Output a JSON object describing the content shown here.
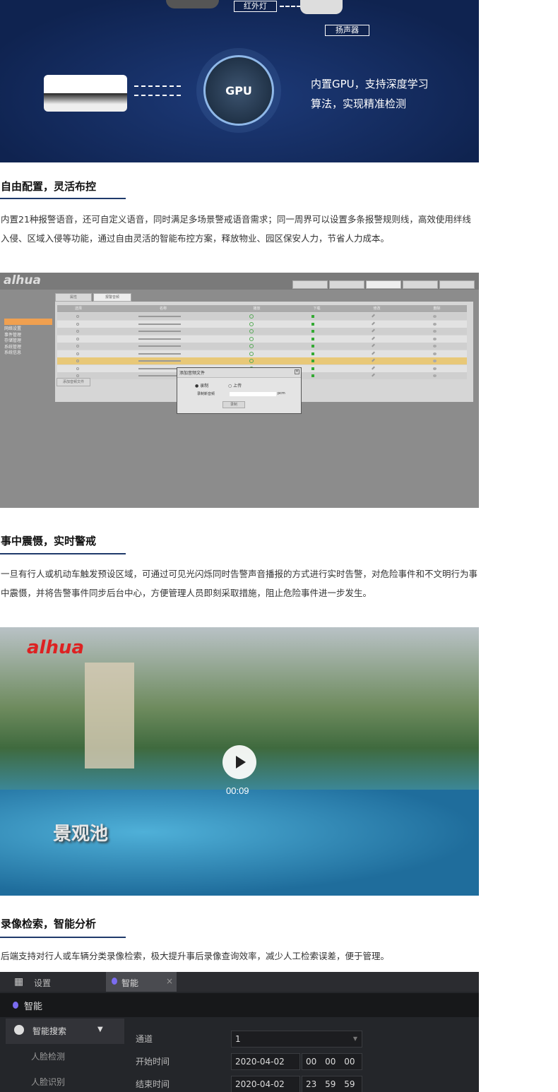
{
  "hero": {
    "label_ir": "红外灯",
    "label_speaker": "扬声器",
    "gpu_chip": "GPU",
    "gpu_text_1": "内置GPU，支持深度学习",
    "gpu_text_2": "算法，实现精准检测",
    "bg_color": "#142a5c"
  },
  "section1": {
    "title": "自由配置，灵活布控",
    "body": "内置21种报警语音，还可自定义语音，同时满足多场景警戒语音需求；同一周界可以设置多条报警规则线，高效使用绊线入侵、区域入侵等功能，通过自由灵活的智能布控方案，释放物业、园区保安人力，节省人力成本。"
  },
  "dahua_ui": {
    "logo": "alhua",
    "nav": [
      "网络设置",
      "事件管理",
      "存储管理",
      "系统管理",
      "系统信息"
    ],
    "tabs": [
      "属性",
      "报警音频"
    ],
    "columns": [
      "选择",
      "名称",
      "播放",
      "下载",
      "修改",
      "删除"
    ],
    "add_button": "添加音频文件",
    "dialog": {
      "title": "添加音频文件",
      "radio_record": "录制",
      "radio_upload": "上传",
      "field_label": "录制新音频",
      "suffix": "pcm",
      "button": "录制"
    }
  },
  "section2": {
    "title": "事中震慑，实时警戒",
    "body": "一旦有行人或机动车触发预设区域，可通过可见光闪烁同时告警声音播报的方式进行实时告警，对危险事件和不文明行为事中震慑，并将告警事件同步后台中心，方便管理人员即刻采取措施，阻止危险事件进一步发生。"
  },
  "video": {
    "logo": "alhua",
    "caption": "景观池",
    "duration": "00:09",
    "icon": "play-icon"
  },
  "section3": {
    "title": "录像检索，智能分析",
    "body": "后端支持对行人或车辆分类录像检索，极大提升事后录像查询效率，减少人工检索误差，便于管理。"
  },
  "nvr_ui": {
    "tab_settings": "设置",
    "tab_smart": "智能",
    "header": "智能",
    "menu_search": "智能搜索",
    "menu_items": [
      "人脸检测",
      "人脸识别"
    ],
    "channel_label": "通道",
    "channel_value": "1",
    "start_label": "开始时间",
    "start_date": "2020-04-02",
    "start_time": [
      "00",
      "00",
      "00"
    ],
    "end_label": "结束时间",
    "end_date": "2020-04-02",
    "end_time": [
      "23",
      "59",
      "59"
    ]
  }
}
